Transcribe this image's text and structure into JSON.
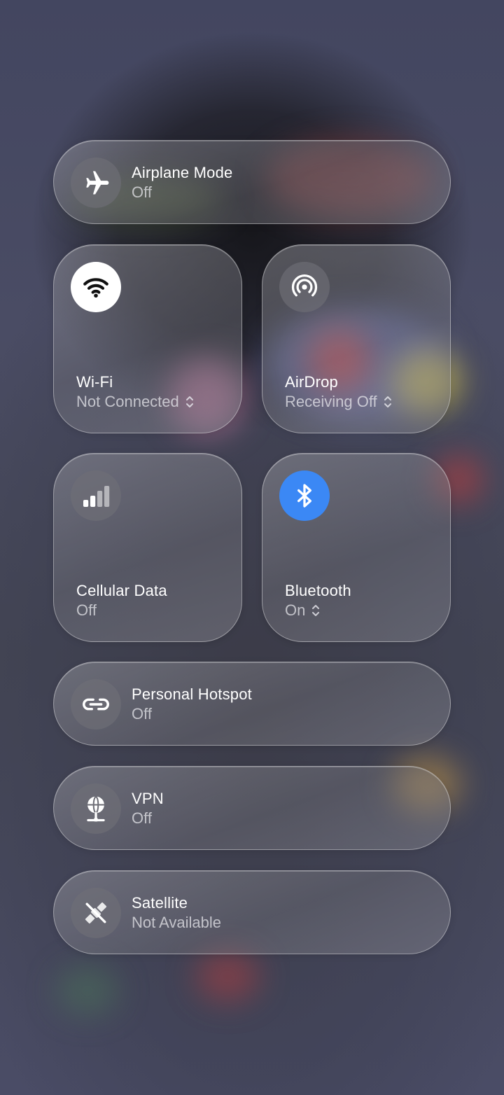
{
  "controls": {
    "airplane": {
      "title": "Airplane Mode",
      "status": "Off",
      "icon": "airplane-icon"
    },
    "wifi": {
      "title": "Wi-Fi",
      "status": "Not Connected",
      "icon": "wifi-icon",
      "active": true
    },
    "airdrop": {
      "title": "AirDrop",
      "status": "Receiving Off",
      "icon": "airdrop-icon"
    },
    "cellular": {
      "title": "Cellular Data",
      "status": "Off",
      "icon": "cellular-signal-icon"
    },
    "bluetooth": {
      "title": "Bluetooth",
      "status": "On",
      "icon": "bluetooth-icon",
      "active": true
    },
    "hotspot": {
      "title": "Personal Hotspot",
      "status": "Off",
      "icon": "link-icon"
    },
    "vpn": {
      "title": "VPN",
      "status": "Off",
      "icon": "globe-network-icon"
    },
    "satellite": {
      "title": "Satellite",
      "status": "Not Available",
      "icon": "satellite-icon"
    }
  },
  "colors": {
    "active_white": "#ffffff",
    "bluetooth_blue": "#3b88f5",
    "inactive_circle": "#6e6e76"
  }
}
